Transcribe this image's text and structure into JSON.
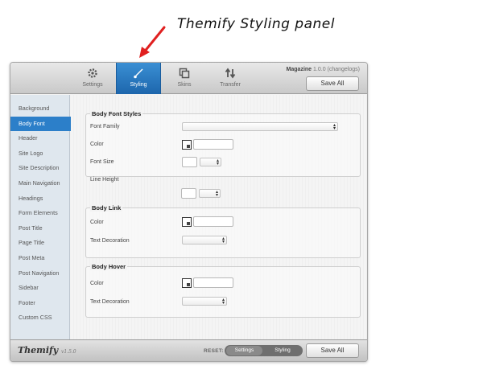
{
  "annotation": {
    "text": "Themify Styling panel"
  },
  "topbar": {
    "tabs": [
      {
        "label": "Settings",
        "icon": "gear-icon"
      },
      {
        "label": "Styling",
        "icon": "brush-icon"
      },
      {
        "label": "Skins",
        "icon": "skins-icon"
      },
      {
        "label": "Transfer",
        "icon": "transfer-icon"
      }
    ],
    "active_tab": "Styling",
    "theme_name": "Magazine",
    "theme_version": "1.0.0 (changelogs)",
    "save_label": "Save All"
  },
  "sidebar": {
    "items": [
      "Background",
      "Body Font",
      "Header",
      "Site Logo",
      "Site Description",
      "Main Navigation",
      "Headings",
      "Form Elements",
      "Post Title",
      "Page Title",
      "Post Meta",
      "Post Navigation",
      "Sidebar",
      "Footer",
      "Custom CSS"
    ],
    "active_item": "Body Font"
  },
  "sections": {
    "body_font_styles": {
      "title": "Body Font Styles",
      "font_family": "Font Family",
      "color": "Color",
      "font_size": "Font Size",
      "line_height": "Line Height"
    },
    "body_link": {
      "title": "Body Link",
      "color": "Color",
      "text_decoration": "Text Decoration"
    },
    "body_hover": {
      "title": "Body Hover",
      "color": "Color",
      "text_decoration": "Text Decoration"
    }
  },
  "bottombar": {
    "logo": "Themify",
    "logo_version": "v1.5.0",
    "reset_label": "RESET:",
    "reset_settings": "Settings",
    "reset_styling": "Styling",
    "save_label": "Save All"
  },
  "colors": {
    "accent": "#2c7fc9",
    "annotation_arrow": "#e02020"
  }
}
